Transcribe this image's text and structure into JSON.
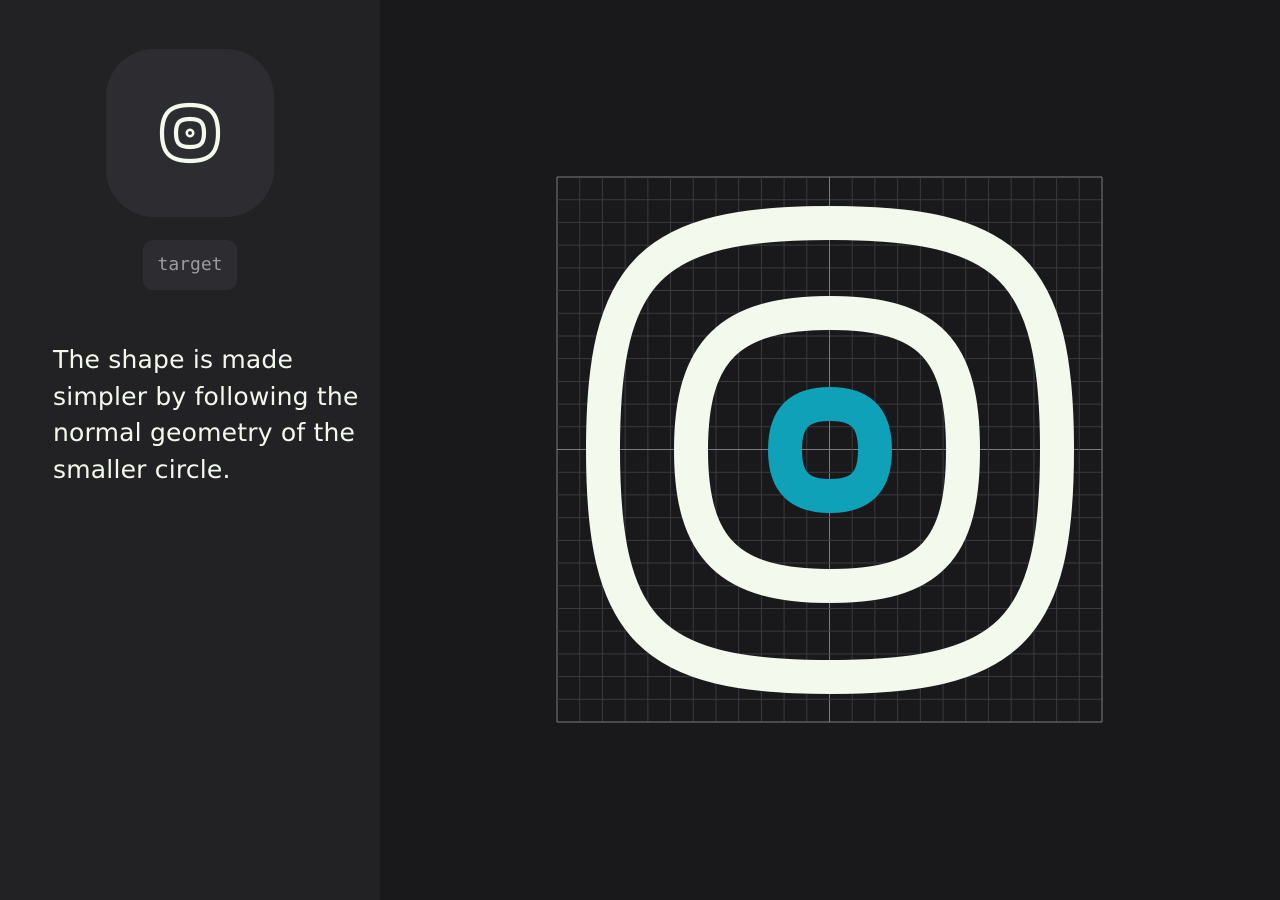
{
  "icon": {
    "name": "target",
    "semantic": "target-icon"
  },
  "sidebar": {
    "description": "The shape is made simpler by following the normal geometry of the smaller circle."
  },
  "colors": {
    "background": "#19191b",
    "sidebar": "#222224",
    "tile": "#2d2d31",
    "stroke": "#f3f9ec",
    "accent": "#0ea1b8",
    "grid": "#3a3a3e",
    "grid_center": "#7a7a7e"
  }
}
